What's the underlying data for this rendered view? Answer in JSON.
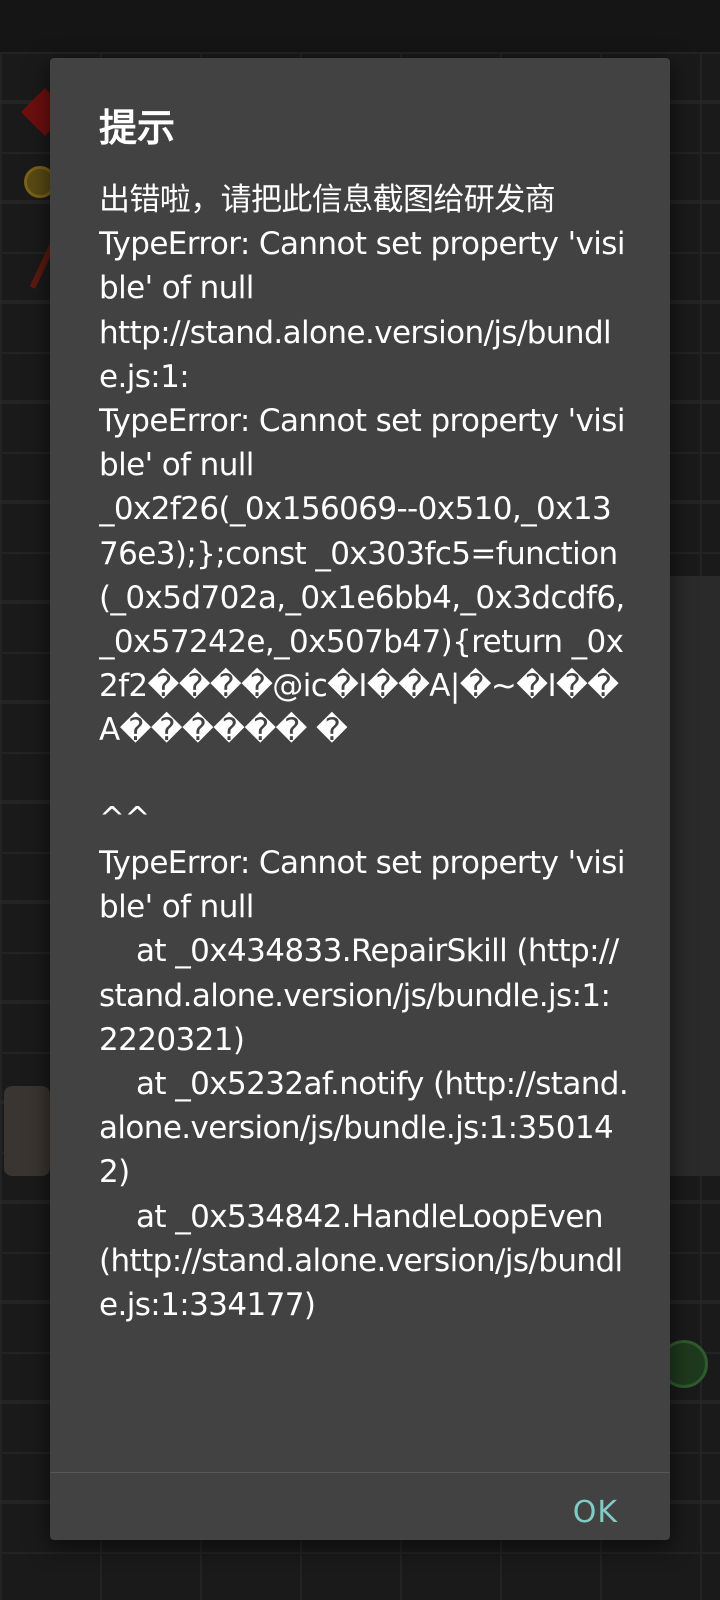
{
  "dialog": {
    "title": "提示",
    "message": "出错啦，请把此信息截图给研发商\nTypeError: Cannot set property 'visible' of null\nhttp://stand.alone.version/js/bundle.js:1:\nTypeError: Cannot set property 'visible' of null\n_0x2f26(_0x156069--0x510,_0x1376e3);};const _0x303fc5=function(_0x5d702a,_0x1e6bb4,_0x3dcdf6,_0x57242e,_0x507b47){return _0x2f2����@ic�I��A|�~�I��A������ �\n\n^^\nTypeError: Cannot set property 'visible' of null\n    at _0x434833.RepairSkill (http://stand.alone.version/js/bundle.js:1:2220321)\n    at _0x5232af.notify (http://stand.alone.version/js/bundle.js:1:350142)\n    at _0x534842.HandleLoopEven (http://stand.alone.version/js/bundle.js:1:334177)",
    "ok_label": "OK"
  },
  "colors": {
    "dialog_background": "#424242",
    "accent": "#80cbc4",
    "text": "#ffffff"
  }
}
